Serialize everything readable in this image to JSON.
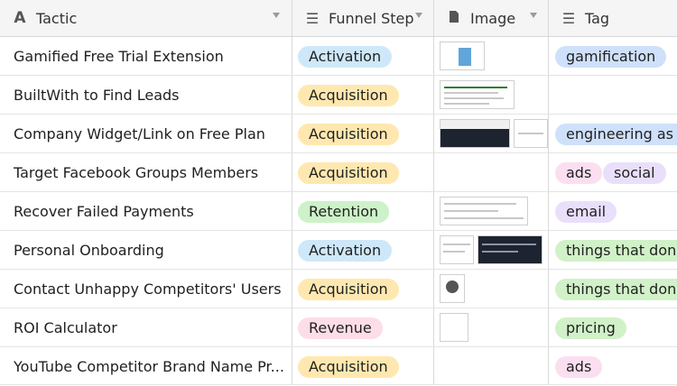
{
  "headers": {
    "tactic": "Tactic",
    "funnel": "Funnel Step",
    "image": "Image",
    "tag": "Tag"
  },
  "icons": {
    "tactic": "text-field-icon",
    "funnel": "single-select-icon",
    "image": "attachment-icon",
    "tag": "multi-select-icon"
  },
  "rows": [
    {
      "tactic": "Gamified Free Trial Extension",
      "funnel": "Activation",
      "tags": [
        "gamification"
      ]
    },
    {
      "tactic": "BuiltWith to Find Leads",
      "funnel": "Acquisition",
      "tags": []
    },
    {
      "tactic": "Company Widget/Link on Free Plan",
      "funnel": "Acquisition",
      "tags": [
        "engineering as m"
      ]
    },
    {
      "tactic": "Target Facebook Groups Members",
      "funnel": "Acquisition",
      "tags": [
        "ads",
        "social"
      ]
    },
    {
      "tactic": "Recover Failed Payments",
      "funnel": "Retention",
      "tags": [
        "email"
      ]
    },
    {
      "tactic": "Personal Onboarding",
      "funnel": "Activation",
      "tags": [
        "things that don't"
      ]
    },
    {
      "tactic": "Contact Unhappy Competitors' Users",
      "funnel": "Acquisition",
      "tags": [
        "things that don't"
      ]
    },
    {
      "tactic": "ROI Calculator",
      "funnel": "Revenue",
      "tags": [
        "pricing"
      ]
    },
    {
      "tactic": "YouTube Competitor Brand Name Pr...",
      "funnel": "Acquisition",
      "tags": [
        "ads"
      ]
    }
  ],
  "colors": {
    "Activation": "#cfe8f9",
    "Acquisition": "#ffe8b0",
    "Retention": "#cdf1c8",
    "Revenue": "#fcdde8"
  }
}
